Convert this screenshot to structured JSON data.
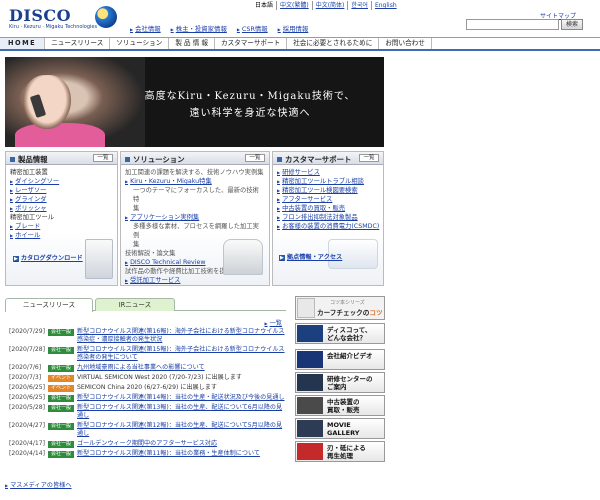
{
  "header": {
    "logo_text": "DISCO",
    "tagline": "Kiru · Kezuru · Migaku Technologies",
    "languages": [
      "日本語",
      "中文(繁體)",
      "中文(简体)",
      "한국어",
      "English"
    ],
    "sitemap_label": "サイトマップ",
    "search_placeholder": "",
    "search_button": "検索",
    "top_links": [
      "会社情報",
      "株主・投資家情報",
      "CSR情報",
      "採用情報"
    ]
  },
  "nav": [
    "HOME",
    "ニュースリリース",
    "ソリューション",
    "製 品 情 報",
    "カスタマーサポート",
    "社会に必要とされるために",
    "お問い合わせ"
  ],
  "hero": {
    "line1": "高度なKiru・Kezuru・Migaku技術で、",
    "line2": "遠い科学を身近な快適へ"
  },
  "panels": {
    "products": {
      "title": "製品情報",
      "list_label": "一覧",
      "group1": "精密加工装置",
      "items1": [
        "ダイシングソー",
        "レーザソー",
        "グラインダ",
        "ポリッシャ"
      ],
      "group2": "精密加工ツール",
      "items2": [
        "ブレード",
        "ホイール"
      ],
      "download": "カタログダウンロード"
    },
    "solution": {
      "title": "ソリューション",
      "list_label": "一覧",
      "intro1": "加工関連の課題を解決する、技術ノウハウ実例集",
      "link1": "Kiru・Kezuru・Migaku特集",
      "desc1a": "一つのテーマにフォーカスした、最新の技術特",
      "desc1b": "集",
      "link2": "アプリケーション実例集",
      "desc2a": "多種多様な素材、プロセスを網羅した加工実例",
      "desc2b": "集",
      "intro2": "技術解説・論文集",
      "link3": "DISCO Technical Review",
      "intro3": "試作品の動作や経費比加工技術を提供",
      "link4": "受託加工サービス"
    },
    "support": {
      "title": "カスタマーサポート",
      "list_label": "一覧",
      "items": [
        "研修サービス",
        "精密加工ツールトラブル相談",
        "精密加工ツール検図要検索",
        "アフターサービス",
        "中古装置の買取・販売",
        "フロン排出抑制法対象製品",
        "お客様の装置の消費電力(CSMDC)"
      ],
      "access": "拠点情報・アクセス"
    }
  },
  "news": {
    "tabs": [
      "ニュースリリース",
      "IRニュース"
    ],
    "more_label": "一覧",
    "rows": [
      {
        "date": "[2020/7/29]",
        "badge": "会社一般",
        "badge_type": "company",
        "text": "新型コロナウイルス関連(第16報)：海外子会社における新型コロナウイルス感染症・濃厚接触者の発生状況"
      },
      {
        "date": "[2020/7/28]",
        "badge": "会社一般",
        "badge_type": "company",
        "text": "新型コロナウイルス関連(第15報)：海外子会社における新型コロナウイルス感染者の発生について"
      },
      {
        "date": "[2020/7/6]",
        "badge": "会社一般",
        "badge_type": "company",
        "text": "九州地域豪雨による当社事業への影響について"
      },
      {
        "date": "[2020/7/3]",
        "badge": "イベント",
        "badge_type": "event",
        "text": "VIRTUAL SEMICON West 2020 (7/20-7/23) に出展します",
        "plain": true
      },
      {
        "date": "[2020/6/25]",
        "badge": "イベント",
        "badge_type": "event",
        "text": "SEMICON China 2020 (6/27-6/29) に出展します",
        "plain": true
      },
      {
        "date": "[2020/6/25]",
        "badge": "会社一般",
        "badge_type": "company",
        "text": "新型コロナウイルス関連(第14報)：当社の生産・配送状況及び今後の見通し"
      },
      {
        "date": "[2020/5/28]",
        "badge": "会社一般",
        "badge_type": "company",
        "text": "新型コロナウイルス関連(第13報)：当社の生産、配送について6月以降の見通し"
      },
      {
        "date": "[2020/4/27]",
        "badge": "会社一般",
        "badge_type": "company",
        "text": "新型コロナウイルス関連(第12報)：当社の生産、配送について5月以降の見通し"
      },
      {
        "date": "[2020/4/17]",
        "badge": "会社一般",
        "badge_type": "company",
        "text": "ゴールデンウィーク期間中のアフターサービス対応"
      },
      {
        "date": "[2020/4/14]",
        "badge": "会社一般",
        "badge_type": "company",
        "text": "新型コロナウイルス関連(第11報)：当社の業務・生産体制について"
      }
    ],
    "mass_media": "マスメディアの皆様へ"
  },
  "sidebar": {
    "kerf_small": "コツ本シリーズ",
    "kerf_big_a": "カーフチェックの",
    "kerf_big_b": "コツ",
    "banners": [
      {
        "line1": "ディスコって、",
        "line2": "どんな会社？",
        "color": "#1c3f7e"
      },
      {
        "line1": "会社紹介ビデオ",
        "line2": "",
        "color": "#1a3576"
      },
      {
        "line1": "研修センターの",
        "line2": "ご案内",
        "color": "#24364f"
      },
      {
        "line1": "中古装置の",
        "line2": "買取・販売",
        "color": "#4a4a4a"
      },
      {
        "line1": "MOVIE",
        "line2": "GALLERY",
        "color": "#2d3b55"
      },
      {
        "line1": "刃・砥による",
        "line2": "再生処理",
        "color": "#c42a2a"
      }
    ]
  }
}
